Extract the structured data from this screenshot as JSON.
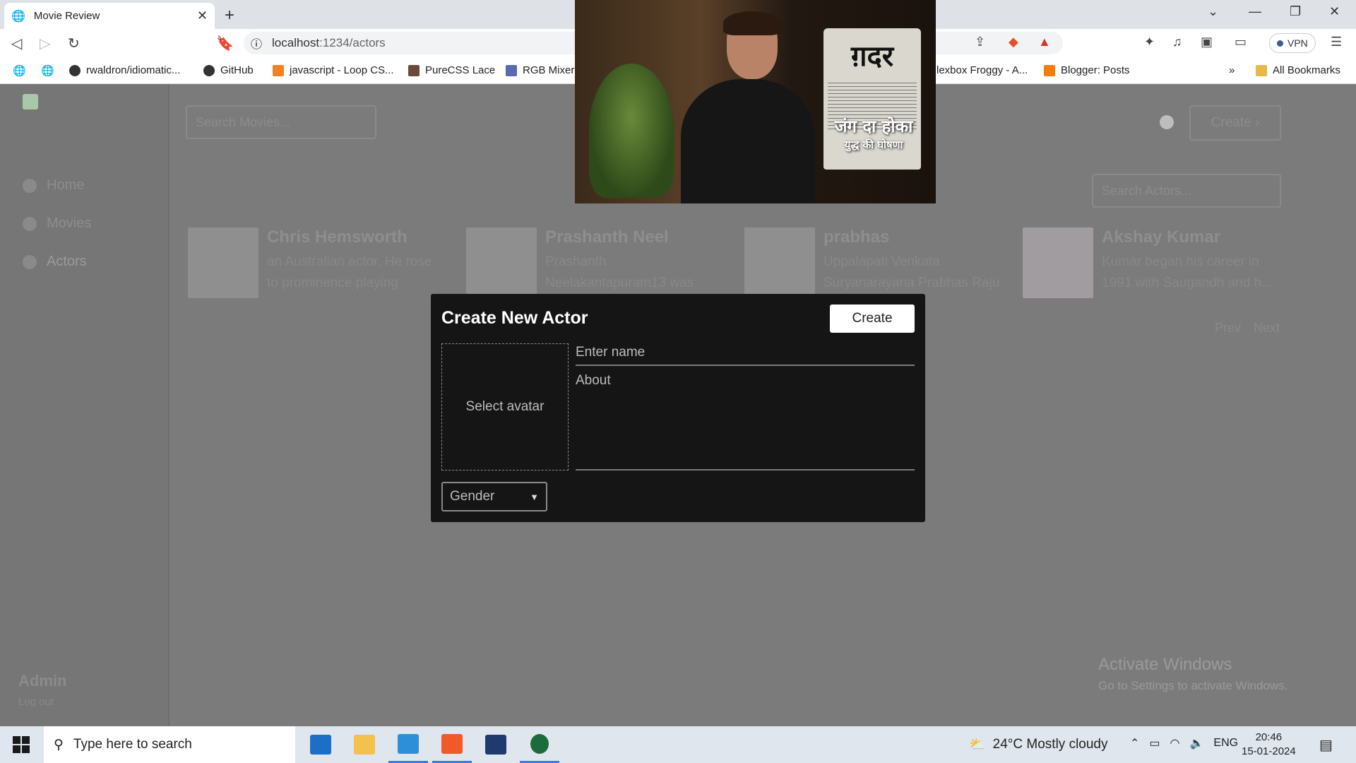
{
  "browser": {
    "tab_title": "Movie Review",
    "tab_close": "✕",
    "new_tab": "+",
    "url_host": "localhost",
    "url_path": ":1234/actors",
    "vpn_label": "VPN",
    "bookmarks": [
      "rwaldron/idiomatic...",
      "GitHub",
      "javascript - Loop CS...",
      "PureCSS Lace",
      "RGB Mixer",
      "lexbox Froggy - A...",
      "Blogger: Posts"
    ],
    "bookmarks_more": "»",
    "all_bookmarks": "All Bookmarks"
  },
  "app": {
    "sidebar": {
      "items": [
        "Home",
        "Movies",
        "Actors"
      ],
      "admin_name": "Admin",
      "logout": "Log out"
    },
    "search_movies_placeholder": "Search Movies...",
    "top_create": "Create",
    "search_actors_placeholder": "Search Actors...",
    "actors": [
      {
        "name": "Chris Hemsworth",
        "about": "an Australian actor. He rose to prominence playing"
      },
      {
        "name": "Prashanth Neel",
        "about": "Prashanth Neelakantapuram13 was"
      },
      {
        "name": "prabhas",
        "about": "Uppalapati Venkata Suryanarayana Prabhas Raju"
      },
      {
        "name": "Akshay Kumar",
        "about": "Kumar began his career in 1991 with Saugandh and h..."
      }
    ],
    "pager": {
      "prev": "Prev",
      "next": "Next"
    }
  },
  "modal": {
    "title": "Create New Actor",
    "create_button": "Create",
    "avatar_label": "Select avatar",
    "name_placeholder": "Enter name",
    "about_placeholder": "About",
    "gender_value": "Gender"
  },
  "video_overlay": {
    "masthead": "ग़दर",
    "headline": "जंग दा होका",
    "subheadline": "युद्ध की घोषणा"
  },
  "watermark": {
    "line1": "Activate Windows",
    "line2": "Go to Settings to activate Windows."
  },
  "taskbar": {
    "search_placeholder": "Type here to search",
    "weather": "24°C  Mostly cloudy",
    "language": "ENG",
    "time": "20:46",
    "date": "15-01-2024"
  }
}
